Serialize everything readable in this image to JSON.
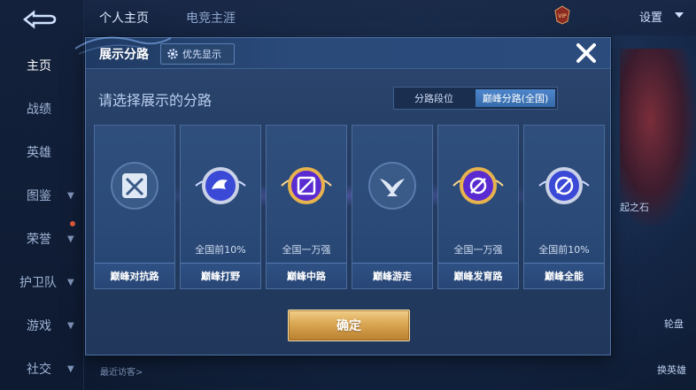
{
  "sidebar": {
    "items": [
      {
        "label": "主页",
        "chevron": false
      },
      {
        "label": "战绩",
        "chevron": false
      },
      {
        "label": "英雄",
        "chevron": false
      },
      {
        "label": "图鉴",
        "chevron": true
      },
      {
        "label": "荣誉",
        "chevron": true
      },
      {
        "label": "护卫队",
        "chevron": true
      },
      {
        "label": "游戏",
        "chevron": true
      },
      {
        "label": "社交",
        "chevron": true
      }
    ]
  },
  "topbar": {
    "tabs": [
      "个人主页",
      "电竞主涯"
    ],
    "settings_label": "设置",
    "vip_label": "VIP"
  },
  "bottom": {
    "recent_visitors": "最近访客>"
  },
  "right_strip": {
    "label_1": "起之石",
    "label_2": "轮盘",
    "label_3": "换英雄"
  },
  "modal": {
    "title": "展示分路",
    "priority_label": "优先显示",
    "prompt": "请选择展示的分路",
    "toggle": [
      "分路段位",
      "巅峰分路(全国)"
    ],
    "toggle_selected": 1,
    "confirm_label": "确定",
    "cards": [
      {
        "name": "巅峰对抗路",
        "rank": "",
        "badge": "greyed",
        "icon": "swords-icon"
      },
      {
        "name": "巅峰打野",
        "rank": "全国前10%",
        "badge": "silver-winged",
        "icon": "dragon-icon"
      },
      {
        "name": "巅峰中路",
        "rank": "全国一万强",
        "badge": "gold-winged",
        "icon": "slash-icon"
      },
      {
        "name": "巅峰游走",
        "rank": "",
        "badge": "greyed",
        "icon": "wings-icon"
      },
      {
        "name": "巅峰发育路",
        "rank": "全国一万强",
        "badge": "gold-winged",
        "icon": "target-icon"
      },
      {
        "name": "巅峰全能",
        "rank": "全国前10%",
        "badge": "silver-winged",
        "icon": "compass-icon"
      }
    ]
  },
  "colors": {
    "accent": "#4e86cc",
    "gold": "#d9a652",
    "panel": "#2b4a77"
  }
}
